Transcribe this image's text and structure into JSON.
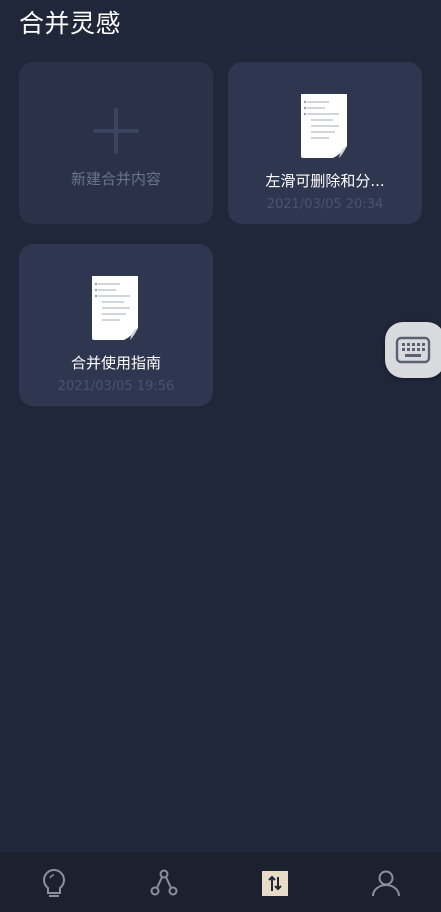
{
  "header": {
    "title": "合并灵感"
  },
  "cards": [
    {
      "type": "new",
      "label": "新建合并内容"
    },
    {
      "type": "note",
      "title": "左滑可删除和分...",
      "date": "2021/03/05 20:34"
    },
    {
      "type": "note",
      "title": "合并使用指南",
      "date": "2021/03/05 19:56"
    }
  ],
  "floating": {
    "icon": "keyboard-icon"
  },
  "bottom_nav": {
    "items": [
      {
        "icon": "lightbulb-icon"
      },
      {
        "icon": "share-nodes-icon"
      },
      {
        "icon": "merge-icon",
        "active": true
      },
      {
        "icon": "person-icon"
      }
    ]
  },
  "colors": {
    "background": "#21273a",
    "card": "#2f3650",
    "nav": "#1c2130",
    "active_accent": "#e8dcc8"
  }
}
